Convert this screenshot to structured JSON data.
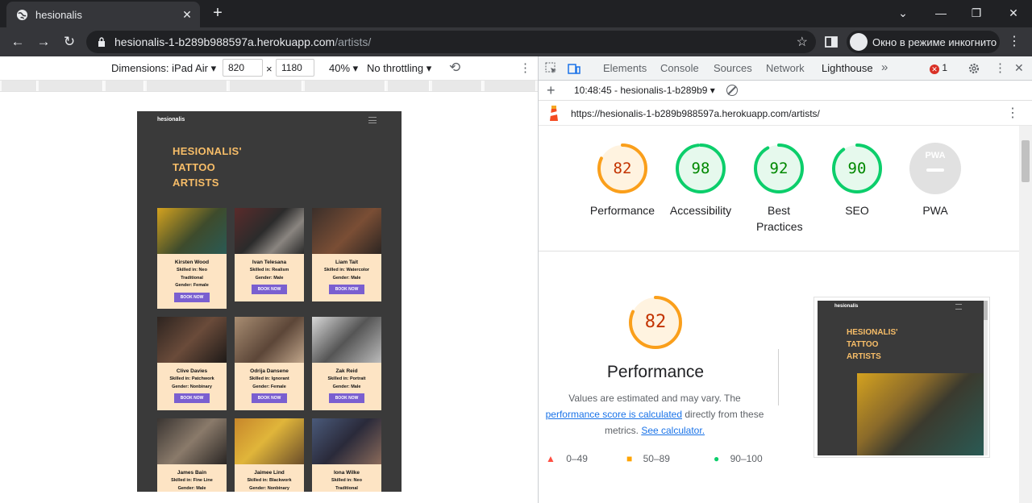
{
  "browser": {
    "tab_title": "hesionalis",
    "url_host": "hesionalis-1-b289b988597a.herokuapp.com",
    "url_path": "/artists/",
    "incognito_label": "Окно в режиме инкогнито"
  },
  "device_toolbar": {
    "dimensions_label": "Dimensions: iPad Air",
    "width": "820",
    "times": "×",
    "height": "1180",
    "zoom": "40%",
    "throttling": "No throttling"
  },
  "emulated_page": {
    "logo": "hesionalis",
    "heading_lines": [
      "HESIONALIS'",
      "TATTOO",
      "ARTISTS"
    ],
    "cards": [
      {
        "name": "Kirsten Wood",
        "lines": [
          "Skilled in: Neo",
          "Traditional",
          "Gender: Female"
        ],
        "button": "BOOK NOW"
      },
      {
        "name": "Ivan Telesana",
        "lines": [
          "Skilled in: Realism",
          "Gender: Male"
        ],
        "button": "BOOK NOW"
      },
      {
        "name": "Liam Tait",
        "lines": [
          "Skilled in: Watercolor",
          "Gender: Male"
        ],
        "button": "BOOK NOW"
      },
      {
        "name": "Clive Davies",
        "lines": [
          "Skilled in: Patchwork",
          "Gender: Nonbinary"
        ],
        "button": "BOOK NOW"
      },
      {
        "name": "Odrija Dansene",
        "lines": [
          "Skilled in: Ignorant",
          "Gender: Female"
        ],
        "button": "BOOK NOW"
      },
      {
        "name": "Zak Reid",
        "lines": [
          "Skilled in: Portrait",
          "Gender: Male"
        ],
        "button": "BOOK NOW"
      },
      {
        "name": "James Bain",
        "lines": [
          "Skilled in: Fine Line",
          "Gender: Male"
        ],
        "button": ""
      },
      {
        "name": "Jaimee Lind",
        "lines": [
          "Skilled in: Blackwork",
          "Gender: Nonbinary"
        ],
        "button": ""
      },
      {
        "name": "Iona Wilke",
        "lines": [
          "Skilled in: Neo",
          "Traditional"
        ],
        "button": ""
      }
    ]
  },
  "devtools": {
    "tabs": [
      "Elements",
      "Console",
      "Sources",
      "Network",
      "Lighthouse"
    ],
    "active_tab": "Lighthouse",
    "more": "»",
    "error_count": "1",
    "report_selector": "10:48:45 - hesionalis-1-b289b9",
    "report_url": "https://hesionalis-1-b289b988597a.herokuapp.com/artists/"
  },
  "lighthouse": {
    "scores": [
      {
        "label": "Performance",
        "value": "82",
        "color": "#fa9f1b"
      },
      {
        "label": "Accessibility",
        "value": "98",
        "color": "#0cce6b"
      },
      {
        "label": "Best Practices",
        "value": "92",
        "color": "#0cce6b"
      },
      {
        "label": "SEO",
        "value": "90",
        "color": "#0cce6b"
      }
    ],
    "pwa_label": "PWA",
    "perf_title": "Performance",
    "perf_desc_1": "Values are estimated and may vary. The",
    "perf_link": "performance score is calculated",
    "perf_desc_2": "directly from these",
    "perf_desc_3": "metrics.",
    "calc_link": "See calculator.",
    "legend": [
      {
        "range": "0–49",
        "color": "#ff4e42"
      },
      {
        "range": "50–89",
        "color": "#ffa400"
      },
      {
        "range": "90–100",
        "color": "#0cce6b"
      }
    ]
  }
}
